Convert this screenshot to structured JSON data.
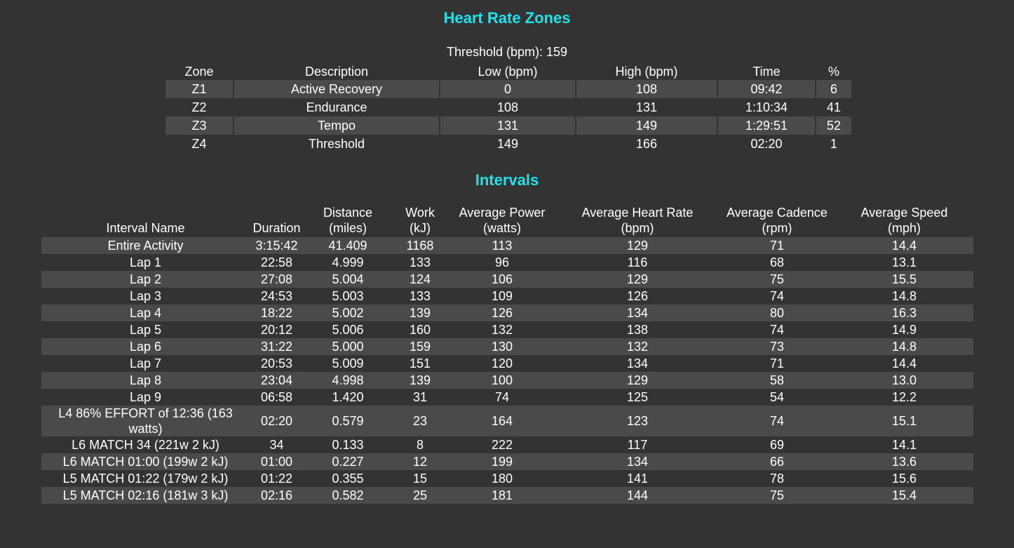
{
  "zones": {
    "title": "Heart Rate Zones",
    "threshold_label": "Threshold (bpm): 159",
    "headers": [
      "Zone",
      "Description",
      "Low (bpm)",
      "High (bpm)",
      "Time",
      "%"
    ],
    "rows": [
      [
        "Z1",
        "Active Recovery",
        "0",
        "108",
        "09:42",
        "6"
      ],
      [
        "Z2",
        "Endurance",
        "108",
        "131",
        "1:10:34",
        "41"
      ],
      [
        "Z3",
        "Tempo",
        "131",
        "149",
        "1:29:51",
        "52"
      ],
      [
        "Z4",
        "Threshold",
        "149",
        "166",
        "02:20",
        "1"
      ]
    ]
  },
  "intervals": {
    "title": "Intervals",
    "headers": [
      [
        "Interval Name"
      ],
      [
        "Duration"
      ],
      [
        "Distance",
        "(miles)"
      ],
      [
        "Work",
        "(kJ)"
      ],
      [
        "Average Power",
        "(watts)"
      ],
      [
        "Average Heart Rate",
        "(bpm)"
      ],
      [
        "Average Cadence",
        "(rpm)"
      ],
      [
        "Average Speed",
        "(mph)"
      ]
    ],
    "rows": [
      [
        "Entire Activity",
        "3:15:42",
        "41.409",
        "1168",
        "113",
        "129",
        "71",
        "14.4"
      ],
      [
        "Lap 1",
        "22:58",
        "4.999",
        "133",
        "96",
        "116",
        "68",
        "13.1"
      ],
      [
        "Lap 2",
        "27:08",
        "5.004",
        "124",
        "106",
        "129",
        "75",
        "15.5"
      ],
      [
        "Lap 3",
        "24:53",
        "5.003",
        "133",
        "109",
        "126",
        "74",
        "14.8"
      ],
      [
        "Lap 4",
        "18:22",
        "5.002",
        "139",
        "126",
        "134",
        "80",
        "16.3"
      ],
      [
        "Lap 5",
        "20:12",
        "5.006",
        "160",
        "132",
        "138",
        "74",
        "14.9"
      ],
      [
        "Lap 6",
        "31:22",
        "5.000",
        "159",
        "130",
        "132",
        "73",
        "14.8"
      ],
      [
        "Lap 7",
        "20:53",
        "5.009",
        "151",
        "120",
        "134",
        "71",
        "14.4"
      ],
      [
        "Lap 8",
        "23:04",
        "4.998",
        "139",
        "100",
        "129",
        "58",
        "13.0"
      ],
      [
        "Lap 9",
        "06:58",
        "1.420",
        "31",
        "74",
        "125",
        "54",
        "12.2"
      ],
      [
        "L4 86% EFFORT of 12:36 (163 watts)",
        "02:20",
        "0.579",
        "23",
        "164",
        "123",
        "74",
        "15.1"
      ],
      [
        "L6 MATCH 34 (221w 2 kJ)",
        "34",
        "0.133",
        "8",
        "222",
        "117",
        "69",
        "14.1"
      ],
      [
        "L6 MATCH 01:00 (199w 2 kJ)",
        "01:00",
        "0.227",
        "12",
        "199",
        "134",
        "66",
        "13.6"
      ],
      [
        "L5 MATCH 01:22 (179w 2 kJ)",
        "01:22",
        "0.355",
        "15",
        "180",
        "141",
        "78",
        "15.6"
      ],
      [
        "L5 MATCH 02:16 (181w 3 kJ)",
        "02:16",
        "0.582",
        "25",
        "181",
        "144",
        "75",
        "15.4"
      ]
    ]
  },
  "colors": {
    "background": "#333333",
    "heading": "#1de3ec",
    "row_shade": "#4a4a4a",
    "text": "#ffffff"
  }
}
